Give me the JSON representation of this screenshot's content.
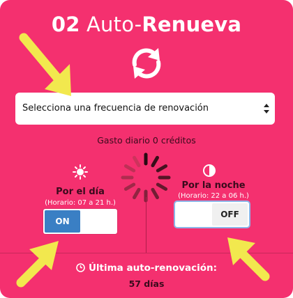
{
  "header": {
    "number": "02",
    "title_regular": "Auto-",
    "title_bold": "Renueva"
  },
  "frequency_select": {
    "label": "Selecciona una frecuencia de renovación"
  },
  "daily_cost": "Gasto diario 0 créditos",
  "day": {
    "label": "Por el día",
    "schedule": "(Horario: 07 a 21 h.)",
    "toggle_on_label": "ON",
    "state": "on"
  },
  "night": {
    "label": "Por la noche",
    "schedule": "(Horario: 22 a 06 h.)",
    "toggle_off_label": "OFF",
    "state": "off"
  },
  "last_renewal": {
    "title": "Última auto-renovación:",
    "value": "57 días"
  },
  "colors": {
    "background": "#f4306f",
    "toggle_on": "#3a7fc4",
    "arrow": "#f2e84e",
    "dark_text": "#3a0a1c"
  },
  "icons": {
    "refresh": "refresh-icon",
    "sun": "sun-icon",
    "moon": "half-moon-icon",
    "spinner": "loading-spinner-icon",
    "clock": "clock-icon",
    "select_caret": "sort-caret-icon"
  }
}
